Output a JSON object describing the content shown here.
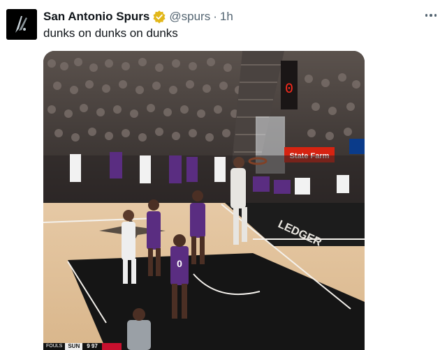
{
  "tweet": {
    "display_name": "San Antonio Spurs",
    "handle": "@spurs",
    "separator": "·",
    "time": "1h",
    "text": "dunks on dunks on dunks"
  },
  "media": {
    "type": "video-still",
    "court_text": "LEDGER",
    "banner_text": "State Farm",
    "shot_clock": "0",
    "jersey_number": "0",
    "scorebug": {
      "fouls_label": "FOULS",
      "team": "SUN",
      "score": "9 97",
      "accent_color": "#c8102e"
    }
  },
  "colors": {
    "verified": "#e2b719",
    "muted": "#536471",
    "state_farm_red": "#d62311",
    "kings_purple": "#5a2d81"
  },
  "icons": {
    "verified": "verified-badge-icon",
    "more": "more-options-icon"
  }
}
